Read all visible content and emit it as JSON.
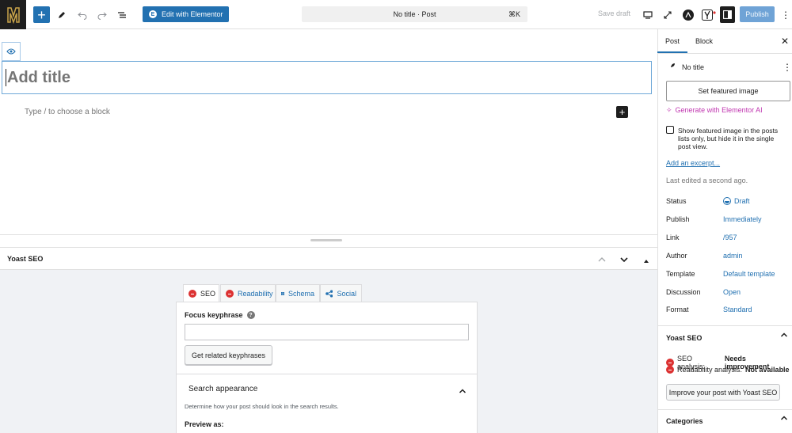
{
  "toolbar": {
    "elementor_label": "Edit with Elementor",
    "command_title": "No title · Post",
    "command_shortcut": "⌘K",
    "save_draft": "Save draft",
    "publish": "Publish"
  },
  "editor": {
    "title_placeholder": "Add title",
    "block_placeholder": "Type / to choose a block"
  },
  "yoast_metabox": {
    "title": "Yoast SEO",
    "tabs": [
      {
        "label": "SEO"
      },
      {
        "label": "Readability"
      },
      {
        "label": "Schema"
      },
      {
        "label": "Social"
      }
    ],
    "focus_keyphrase_label": "Focus keyphrase",
    "related_button": "Get related keyphrases",
    "search_appearance_title": "Search appearance",
    "search_appearance_desc": "Determine how your post should look in the search results.",
    "preview_as": "Preview as:"
  },
  "sidebar": {
    "tabs": [
      {
        "label": "Post"
      },
      {
        "label": "Block"
      }
    ],
    "post_title": "No title",
    "featured_image_button": "Set featured image",
    "generate_ai": "Generate with Elementor AI",
    "featured_checkbox_label": "Show featured image in the posts lists only, but hide it in the single post view.",
    "excerpt_link": "Add an excerpt...",
    "last_edited": "Last edited a second ago.",
    "meta": [
      {
        "label": "Status",
        "value": "Draft"
      },
      {
        "label": "Publish",
        "value": "Immediately"
      },
      {
        "label": "Link",
        "value": "/957"
      },
      {
        "label": "Author",
        "value": "admin"
      },
      {
        "label": "Template",
        "value": "Default template"
      },
      {
        "label": "Discussion",
        "value": "Open"
      },
      {
        "label": "Format",
        "value": "Standard"
      }
    ],
    "yoast_title": "Yoast SEO",
    "seo_analysis_label": "SEO analysis:",
    "seo_analysis_value": "Needs improvement",
    "readability_label": "Readability analysis:",
    "readability_value": "Not available",
    "improve_button": "Improve your post with Yoast SEO",
    "categories_title": "Categories"
  },
  "colors": {
    "accent": "#2271b1",
    "error": "#dc3232",
    "ai": "#c036b0"
  }
}
